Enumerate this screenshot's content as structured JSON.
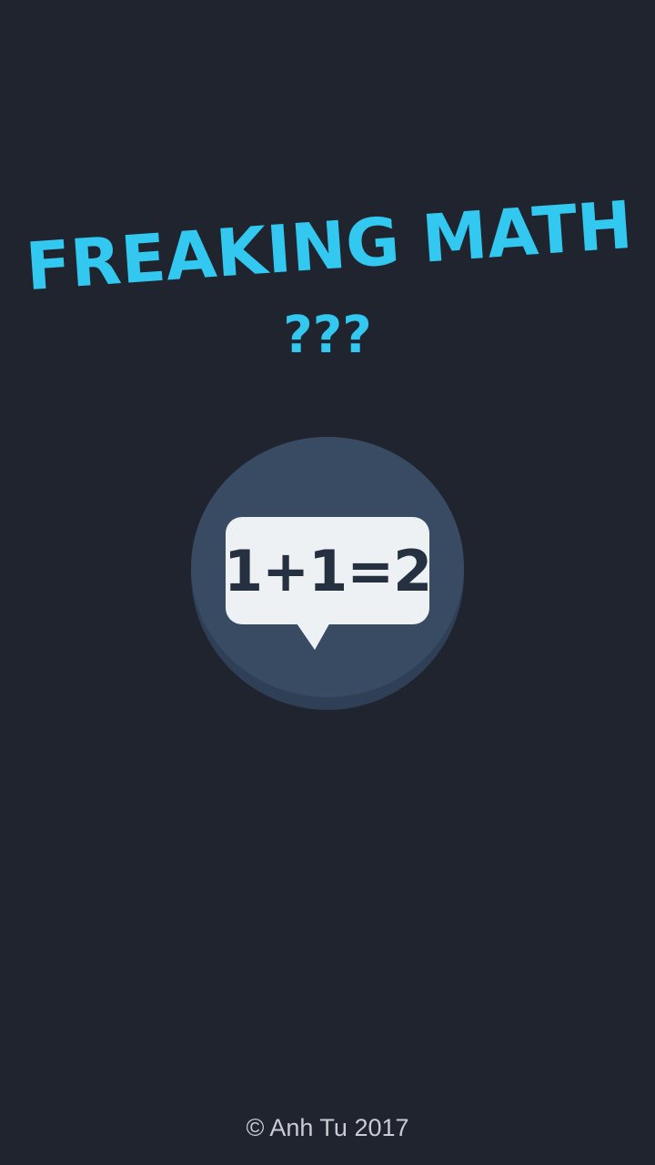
{
  "app": {
    "title_line1": "FREAKING MATH",
    "title_line2": "???"
  },
  "play_button": {
    "equation": "1+1=2",
    "icon": "speech-bubble-icon"
  },
  "footer": {
    "copyright": "© Anh Tu 2017"
  },
  "colors": {
    "background": "#1f242f",
    "title": "#33c8f0",
    "button_face": "#384b62",
    "button_shadow": "#2f3f56",
    "bubble": "#eef1f3",
    "equation_text": "#253041",
    "footer_text": "#c9ccd2"
  }
}
